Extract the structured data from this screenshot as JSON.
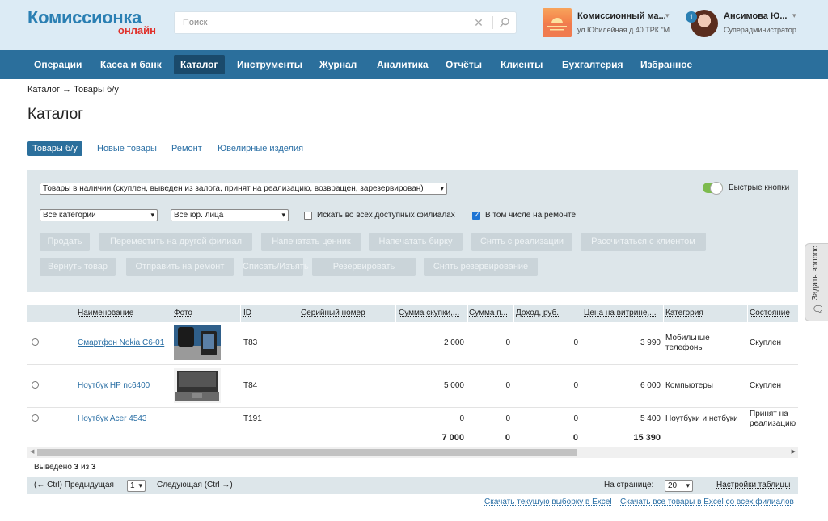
{
  "header": {
    "logo_line1": "Комиссионка",
    "logo_line2": "онлайн",
    "search_placeholder": "Поиск",
    "store_name": "Комиссионный ма...",
    "store_address": "ул.Юбилейная д.40 ТРК \"М...",
    "notification_count": "1",
    "user_name": "Ансимова Ю...",
    "user_role": "Суперадминистратор"
  },
  "nav": {
    "items": [
      "Операции",
      "Касса и банк",
      "Каталог",
      "Инструменты",
      "Журнал",
      "Аналитика",
      "Отчёты",
      "Клиенты",
      "Бухгалтерия",
      "Избранное"
    ],
    "active": "Каталог"
  },
  "breadcrumb": "Каталог → Товары б/у",
  "page_title": "Каталог",
  "tabs": [
    "Товары б/у",
    "Новые товары",
    "Ремонт",
    "Ювелирные изделия"
  ],
  "filters": {
    "status_select": "Товары в наличии (скуплен, выведен из залога, принят на реализацию, возвращен, зарезервирован)",
    "category_select": "Все категории",
    "entity_select": "Все юр. лица",
    "search_all_branches": "Искать во всех доступных филиалах",
    "search_all_branches_checked": false,
    "include_repair": "В том числе на ремонте",
    "include_repair_checked": true,
    "quick_buttons": "Быстрые кнопки",
    "quick_buttons_on": true
  },
  "actions": {
    "row1": [
      "Продать",
      "Переместить на другой филиал",
      "Напечатать ценник",
      "Напечатать бирку",
      "Снять с реализации",
      "Рассчитаться с клиентом"
    ],
    "row2": [
      "Вернуть товар",
      "Отправить на ремонт",
      "Списать/Изъять",
      "Резервировать",
      "Снять резервирование"
    ]
  },
  "table": {
    "columns": [
      "Наименование",
      "Фото",
      "ID",
      "Серийный номер",
      "Сумма скупки,...",
      "Сумма п...",
      "Доход, руб.",
      "Цена на витрине,...",
      "Категория",
      "Состояние"
    ],
    "rows": [
      {
        "name": "Смартфон Nokia C6-01",
        "id": "T83",
        "serial": "",
        "buy": "2 000",
        "sum": "0",
        "income": "0",
        "price": "3 990",
        "category": "Мобильные телефоны",
        "state": "Скуплен",
        "photo": "phone"
      },
      {
        "name": "Ноутбук HP nc6400",
        "id": "T84",
        "serial": "",
        "buy": "5 000",
        "sum": "0",
        "income": "0",
        "price": "6 000",
        "category": "Компьютеры",
        "state": "Скуплен",
        "photo": "laptop"
      },
      {
        "name": "Ноутбук Acer 4543",
        "id": "T191",
        "serial": "",
        "buy": "0",
        "sum": "0",
        "income": "0",
        "price": "5 400",
        "category": "Ноутбуки и нетбуки",
        "state": "Принят на реализацию",
        "photo": ""
      }
    ],
    "totals": {
      "buy": "7 000",
      "sum": "0",
      "income": "0",
      "price": "15 390"
    }
  },
  "summary": {
    "prefix": "Выведено",
    "shown": "3",
    "of": "из",
    "total": "3"
  },
  "pager": {
    "prev": "(← Ctrl) Предыдущая",
    "page": "1",
    "next": "Следующая (Ctrl →)",
    "per_page_label": "На странице:",
    "per_page": "20",
    "settings": "Настройки таблицы"
  },
  "downloads": {
    "current": "Скачать текущую выборку в Excel",
    "all": "Скачать все товары в Excel со всех филиалов"
  },
  "feedback": "Задать вопрос"
}
